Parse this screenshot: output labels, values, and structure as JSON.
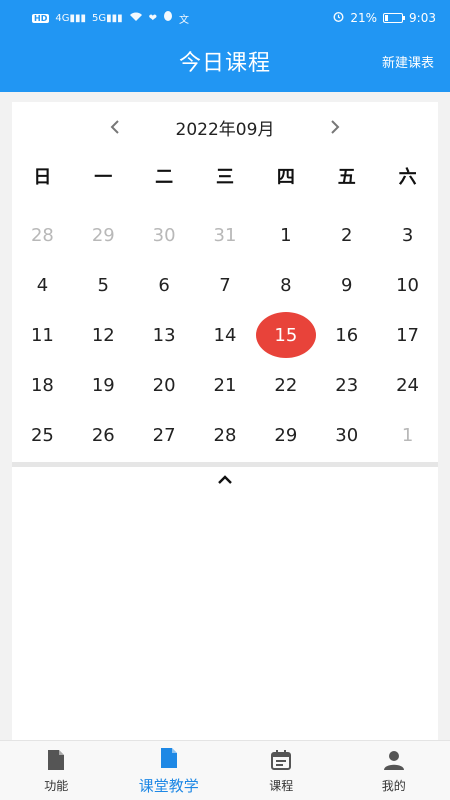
{
  "status_bar": {
    "left_icons": [
      "hd-icon",
      "signal-4g-icon",
      "signal-5g-icon",
      "wifi-icon",
      "heart-icon",
      "qq-icon",
      "translate-icon"
    ],
    "hd_label": "HD",
    "net_label_1": "4G",
    "net_label_2": "5G",
    "battery_percent": "21%",
    "battery_level": 0.21,
    "time": "9:03"
  },
  "app_bar": {
    "title": "今日课程",
    "action_label": "新建课表"
  },
  "calendar": {
    "month_label": "2022年09月",
    "weekdays": [
      "日",
      "一",
      "二",
      "三",
      "四",
      "五",
      "六"
    ],
    "days": [
      {
        "label": "28",
        "muted": true
      },
      {
        "label": "29",
        "muted": true
      },
      {
        "label": "30",
        "muted": true
      },
      {
        "label": "31",
        "muted": true
      },
      {
        "label": "1"
      },
      {
        "label": "2"
      },
      {
        "label": "3"
      },
      {
        "label": "4"
      },
      {
        "label": "5"
      },
      {
        "label": "6"
      },
      {
        "label": "7"
      },
      {
        "label": "8"
      },
      {
        "label": "9"
      },
      {
        "label": "10"
      },
      {
        "label": "11"
      },
      {
        "label": "12"
      },
      {
        "label": "13"
      },
      {
        "label": "14"
      },
      {
        "label": "15",
        "selected": true
      },
      {
        "label": "16"
      },
      {
        "label": "17"
      },
      {
        "label": "18"
      },
      {
        "label": "19"
      },
      {
        "label": "20"
      },
      {
        "label": "21"
      },
      {
        "label": "22"
      },
      {
        "label": "23"
      },
      {
        "label": "24"
      },
      {
        "label": "25"
      },
      {
        "label": "26"
      },
      {
        "label": "27"
      },
      {
        "label": "28"
      },
      {
        "label": "29"
      },
      {
        "label": "30"
      },
      {
        "label": "1",
        "muted": true
      }
    ],
    "selected_color": "#e8433a"
  },
  "tabs": [
    {
      "label": "功能",
      "icon": "file-icon",
      "active": false
    },
    {
      "label": "课堂教学",
      "icon": "file-icon",
      "active": true
    },
    {
      "label": "课程",
      "icon": "calendar-icon",
      "active": false
    },
    {
      "label": "我的",
      "icon": "user-icon",
      "active": false
    }
  ],
  "colors": {
    "primary": "#2196f3",
    "active_tab": "#1e88e5",
    "selected_day": "#e8433a"
  }
}
